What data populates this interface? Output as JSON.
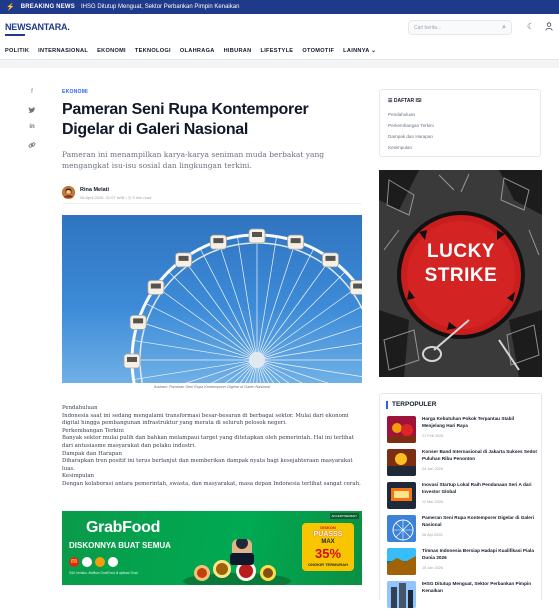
{
  "ticker": {
    "label": "BREAKING NEWS",
    "text": "IHSG Ditutup Menguat, Sektor Perbankan Pimpin Kenaikan"
  },
  "header": {
    "logo": "NEWSANTARA.",
    "search_placeholder": "Cari berita..."
  },
  "nav": [
    "POLITIK",
    "INTERNASIONAL",
    "EKONOMI",
    "TEKNOLOGI",
    "OLAHRAGA",
    "HIBURAN",
    "LIFESTYLE",
    "OTOMOTIF",
    "LAINNYA"
  ],
  "share": {
    "icons": [
      "facebook-icon",
      "twitter-icon",
      "linkedin-icon",
      "link-icon"
    ]
  },
  "article": {
    "category": "EKONOMI",
    "title": "Pameran Seni Rupa Kontemporer Digelar di Galeri Nasional",
    "subtitle": "Pameran ini menampilkan karya-karya seniman muda berbakat yang mengangkat isu-isu sosial dan lingkungan terkini.",
    "author": "Rina Melati",
    "meta": "08 April 2026, 21:07 WIB  •  ◷ 5 min read",
    "caption": "Ilustrasi: Pameran Seni Rupa Kontemporer Digelar di Galeri Nasional",
    "body": [
      "Pendahuluan",
      "Indonesia saat ini sedang mengalami transformasi besar-besaran di berbagai sektor. Mulai dari ekonomi digital hingga pembangunan infrastruktur yang merata di seluruh pelosok negeri.",
      "Perkembangan Terkini",
      "Banyak sektor mulai pulih dan bahkan melampaui target yang ditetapkan oleh pemerintah. Hal ini terlihat dari antusiasme masyarakat dan pelaku industri.",
      "Dampak dan Harapan",
      "Diharapkan tren positif ini terus berlanjut dan memberikan dampak nyata bagi kesejahteraan masyarakat luas.",
      "Kesimpulan",
      "Dengan kolaborasi antara pemerintah, swasta, dan masyarakat, masa depan Indonesia terlihat sangat cerah."
    ]
  },
  "ad_banner": {
    "brand": "GrabFood",
    "headline": "DISKONNYA BUAT SEMUA",
    "tag": "ADVERTISEMENT",
    "badge_l1": "DISKON",
    "badge_l2": "PUASSS",
    "badge_l3": "MAX",
    "badge_l4": "35%",
    "badge_l5": "ONGKIR TERMURAH",
    "footnote": "S&K berlaku. Aktifkan GrabFood di aplikasi Grab."
  },
  "toc": {
    "heading": "DAFTAR ISI",
    "items": [
      "Pendahuluan",
      "Perkembangan Terkini",
      "Dampak dan Harapan",
      "Kesimpulan"
    ]
  },
  "side_ad": {
    "line1": "LUCKY",
    "line2": "STRIKE"
  },
  "popular": {
    "heading": "TERPOPULER",
    "items": [
      {
        "title": "Harga Kebutuhan Pokok Terpantau Stabil Menjelang Hari Raya",
        "date": "21 Feb 2026"
      },
      {
        "title": "Konser Band Internasional di Jakarta Sukses Sedot Puluhan Ribu Penonton",
        "date": "04 Jan 2026"
      },
      {
        "title": "Inovasi Startup Lokal Raih Pendanaan Seri A dari Investor Global",
        "date": "11 Mar 2026"
      },
      {
        "title": "Pameran Seni Rupa Kontemporer Digelar di Galeri Nasional",
        "date": "08 Apr 2026"
      },
      {
        "title": "Timnas Indonesia Bersiap Hadapi Kualifikasi Piala Dunia 2026",
        "date": "15 Jan 2026"
      },
      {
        "title": "IHSG Ditutup Menguat, Sektor Perbankan Pimpin Kenaikan",
        "date": ""
      }
    ]
  },
  "colors": {
    "brand": "#1e3a8a",
    "accent": "#2563eb",
    "ticker_bg": "#1f3a8a"
  }
}
